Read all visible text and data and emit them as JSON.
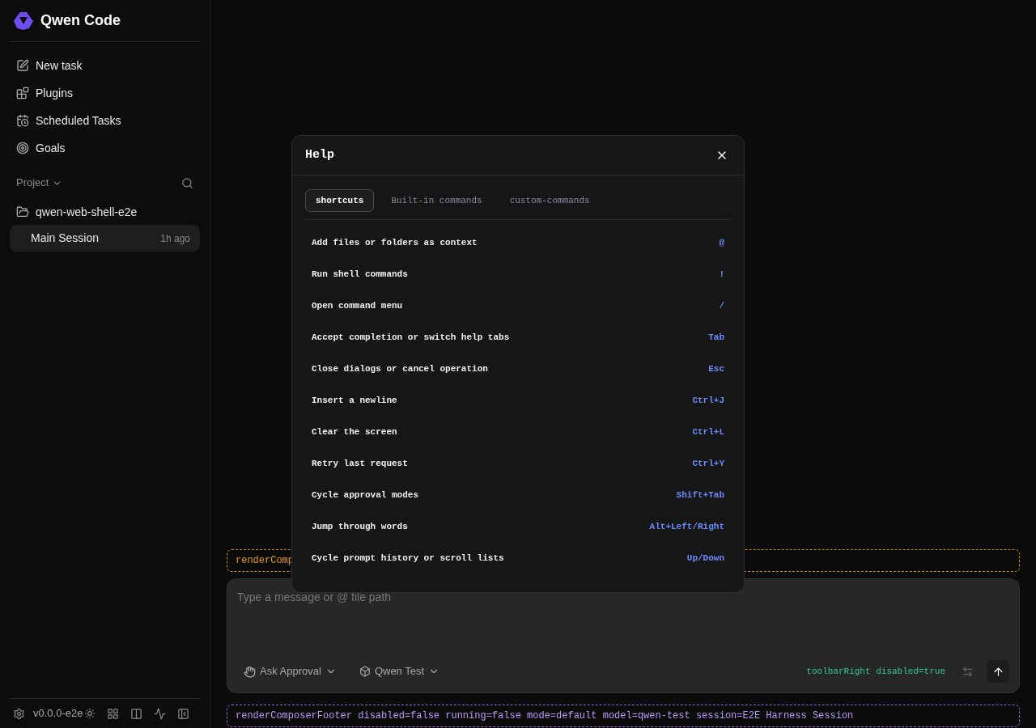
{
  "sidebar": {
    "app_name": "Qwen Code",
    "nav_items": [
      {
        "kind": "new",
        "label": "New task"
      },
      {
        "kind": "plugins",
        "label": "Plugins"
      },
      {
        "kind": "scheduled",
        "label": "Scheduled Tasks"
      },
      {
        "kind": "goals",
        "label": "Goals"
      }
    ],
    "section_label": "Project",
    "project": {
      "name": "qwen-web-shell-e2e",
      "sessions": [
        {
          "title": "Main Session",
          "time": "1h ago",
          "selected": true
        }
      ]
    },
    "version": "v0.0.0-e2e"
  },
  "debug_bar_top": "renderComp",
  "composer": {
    "placeholder": "Type a message or @ file path",
    "mode": "Ask Approval",
    "model": "Qwen Test",
    "toolbar_right": "toolbarRight disabled=true"
  },
  "debug_bar_bottom": "renderComposerFooter disabled=false running=false mode=default model=qwen-test session=E2E Harness Session",
  "dialog": {
    "title": "Help",
    "tabs": [
      {
        "label": "shortcuts",
        "selected": true
      },
      {
        "label": "Built-in commands",
        "selected": false
      },
      {
        "label": "custom-commands",
        "selected": false
      }
    ],
    "shortcuts": [
      {
        "action": "Add files or folders as context",
        "key": "@"
      },
      {
        "action": "Run shell commands",
        "key": "!"
      },
      {
        "action": "Open command menu",
        "key": "/"
      },
      {
        "action": "Accept completion or switch help tabs",
        "key": "Tab"
      },
      {
        "action": "Close dialogs or cancel operation",
        "key": "Esc"
      },
      {
        "action": "Insert a newline",
        "key": "Ctrl+J"
      },
      {
        "action": "Clear the screen",
        "key": "Ctrl+L"
      },
      {
        "action": "Retry last request",
        "key": "Ctrl+Y"
      },
      {
        "action": "Cycle approval modes",
        "key": "Shift+Tab"
      },
      {
        "action": "Jump through words",
        "key": "Alt+Left/Right"
      },
      {
        "action": "Cycle prompt history or scroll lists",
        "key": "Up/Down"
      }
    ]
  }
}
